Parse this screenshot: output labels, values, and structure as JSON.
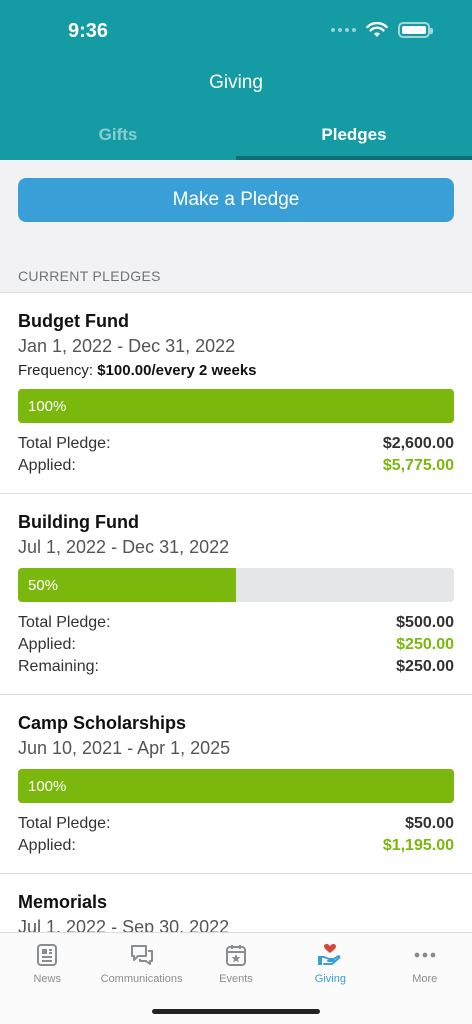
{
  "status_bar": {
    "time": "9:36"
  },
  "nav": {
    "title": "Giving"
  },
  "tabs": [
    {
      "label": "Gifts",
      "active": false
    },
    {
      "label": "Pledges",
      "active": true
    }
  ],
  "cta": {
    "label": "Make a Pledge"
  },
  "section": {
    "label": "CURRENT PLEDGES"
  },
  "pledges": [
    {
      "fund": "Budget Fund",
      "dates": "Jan 1, 2022 - Dec 31, 2022",
      "frequency_label": "Frequency:",
      "frequency_value": "$100.00/every 2 weeks",
      "progress_pct": 100,
      "progress_label": "100%",
      "total_label": "Total Pledge:",
      "total_value": "$2,600.00",
      "applied_label": "Applied:",
      "applied_value": "$5,775.00"
    },
    {
      "fund": "Building Fund",
      "dates": "Jul 1, 2022 - Dec 31, 2022",
      "progress_pct": 50,
      "progress_label": "50%",
      "total_label": "Total Pledge:",
      "total_value": "$500.00",
      "applied_label": "Applied:",
      "applied_value": "$250.00",
      "remaining_label": "Remaining:",
      "remaining_value": "$250.00"
    },
    {
      "fund": "Camp Scholarships",
      "dates": "Jun 10, 2021 - Apr 1, 2025",
      "progress_pct": 100,
      "progress_label": "100%",
      "total_label": "Total Pledge:",
      "total_value": "$50.00",
      "applied_label": "Applied:",
      "applied_value": "$1,195.00"
    },
    {
      "fund": "Memorials",
      "dates": "Jul 1, 2022 - Sep 30, 2022"
    }
  ],
  "tabbar": [
    {
      "label": "News",
      "icon": "news-icon"
    },
    {
      "label": "Communications",
      "icon": "chat-bubbles-icon"
    },
    {
      "label": "Events",
      "icon": "calendar-star-icon"
    },
    {
      "label": "Giving",
      "icon": "hand-heart-icon",
      "active": true
    },
    {
      "label": "More",
      "icon": "more-dots-icon"
    }
  ],
  "colors": {
    "header": "#159ba3",
    "accent_blue": "#3a9fd6",
    "progress_green": "#7ab80e"
  }
}
